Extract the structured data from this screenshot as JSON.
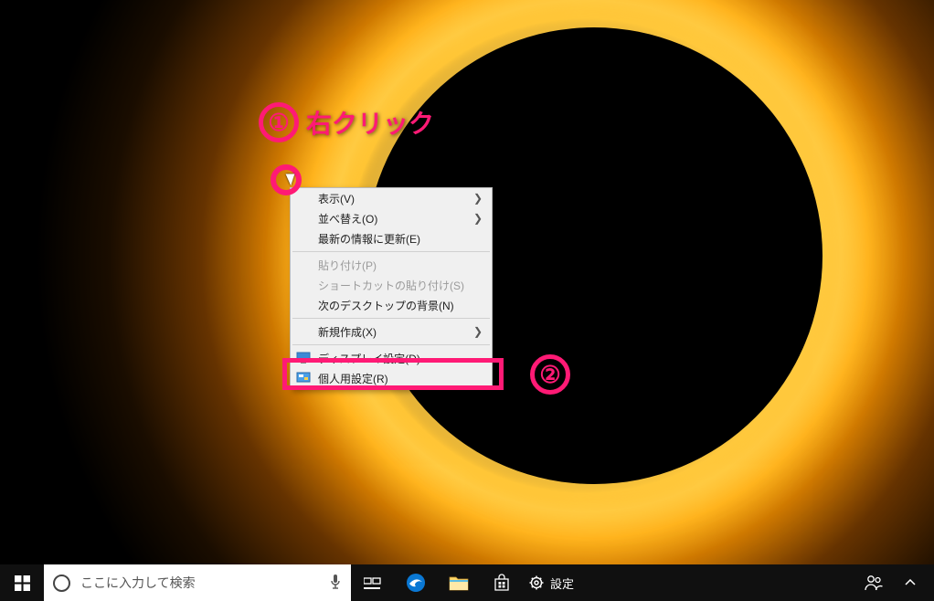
{
  "annotations": {
    "step1_number": "①",
    "step1_label": "右クリック",
    "step2_number": "②"
  },
  "context_menu": {
    "view": "表示(V)",
    "sort": "並べ替え(O)",
    "refresh": "最新の情報に更新(E)",
    "paste": "貼り付け(P)",
    "paste_shortcut": "ショートカットの貼り付け(S)",
    "next_desktop_bg": "次のデスクトップの背景(N)",
    "new": "新規作成(X)",
    "display_settings": "ディスプレイ設定(D)",
    "personalize": "個人用設定(R)"
  },
  "taskbar": {
    "search_placeholder": "ここに入力して検索",
    "settings_label": "設定"
  }
}
